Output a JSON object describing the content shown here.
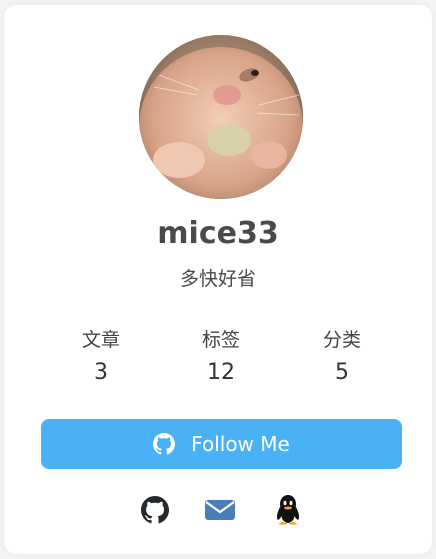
{
  "profile": {
    "name": "mice33",
    "motto": "多快好省"
  },
  "stats": [
    {
      "label": "文章",
      "value": "3"
    },
    {
      "label": "标签",
      "value": "12"
    },
    {
      "label": "分类",
      "value": "5"
    }
  ],
  "follow_button": {
    "label": "Follow Me",
    "icon": "github-icon"
  },
  "social_icons": [
    "github-icon",
    "mail-icon",
    "qq-icon"
  ],
  "colors": {
    "accent": "#49b1f5",
    "mail": "#4a7ebb",
    "text": "#4a4a4a",
    "icon_dark": "#24292e"
  }
}
